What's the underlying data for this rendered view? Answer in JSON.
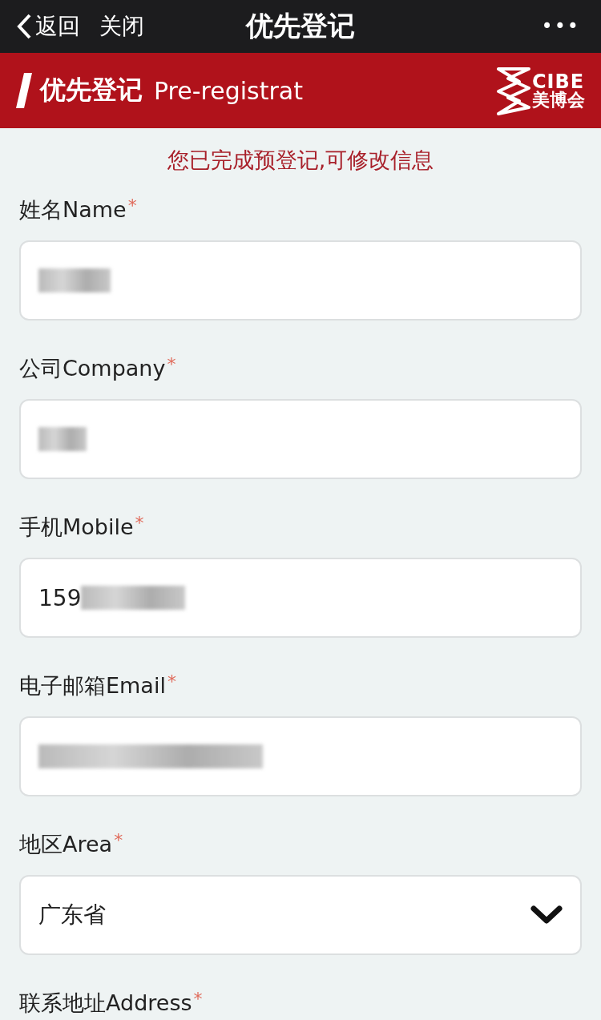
{
  "nav_bar": {
    "back": "返回",
    "close": "关闭",
    "title": "优先登记",
    "more": "•••"
  },
  "banner": {
    "title": "优先登记",
    "subtitle": "Pre-registrat",
    "logo": {
      "latin": "CIBE",
      "chinese": "美博会"
    }
  },
  "notice": "您已完成预登记,可修改信息",
  "fields": [
    {
      "kind": "text",
      "label": "姓名Name",
      "required_mark": "*",
      "redacted": true
    },
    {
      "kind": "text",
      "label": "公司Company",
      "required_mark": "*",
      "redacted": true
    },
    {
      "kind": "text",
      "label": "手机Mobile",
      "required_mark": "*",
      "value": "159",
      "redacted": true
    },
    {
      "kind": "text",
      "label": "电子邮箱Email",
      "required_mark": "*",
      "redacted": true
    },
    {
      "kind": "select",
      "label": "地区Area",
      "required_mark": "*",
      "value": "广东省"
    },
    {
      "kind": "text",
      "label": "联系地址Address",
      "required_mark": "*"
    }
  ]
}
